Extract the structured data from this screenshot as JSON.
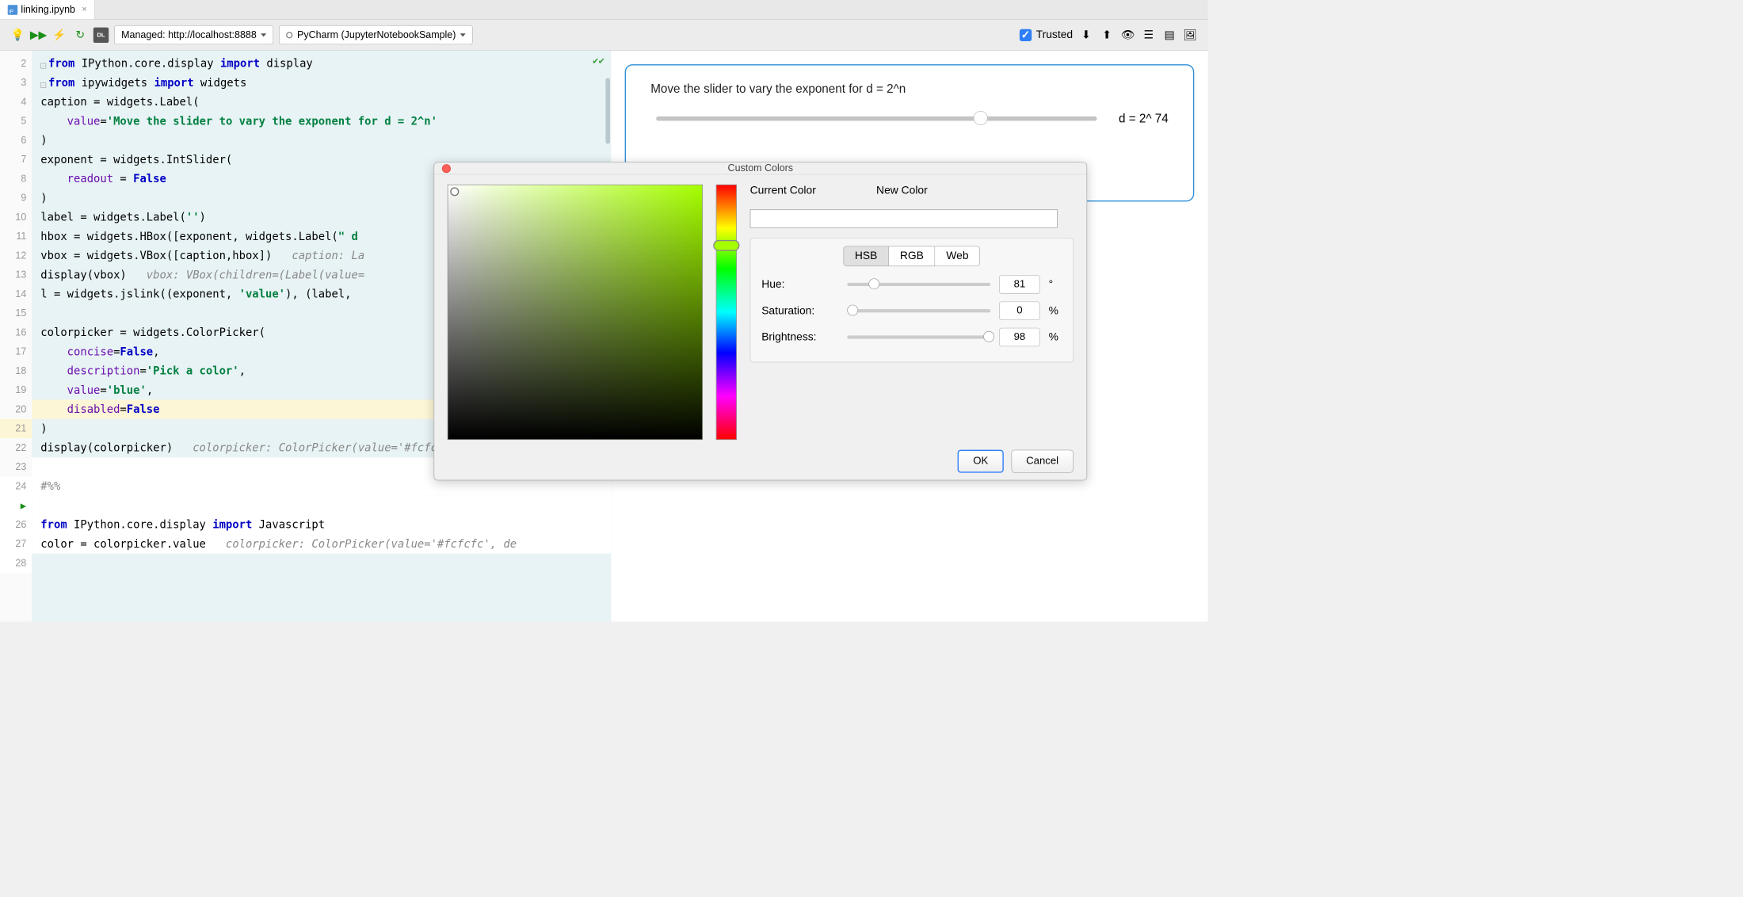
{
  "tab": {
    "filename": "linking.ipynb"
  },
  "toolbar": {
    "managed": "Managed: http://localhost:8888",
    "kernel": "PyCharm (JupyterNotebookSample)",
    "trusted": "Trusted"
  },
  "gutter": {
    "start": 2,
    "end": 28,
    "highlight": 21,
    "run_marker_at": 25
  },
  "code": [
    {
      "n": 2,
      "seg": [
        [
          "kw",
          "from"
        ],
        [
          "nm",
          " IPython.core.display "
        ],
        [
          "kw",
          "import"
        ],
        [
          "nm",
          " display"
        ]
      ]
    },
    {
      "n": 3,
      "seg": [
        [
          "kw",
          "from"
        ],
        [
          "nm",
          " ipywidgets "
        ],
        [
          "kw",
          "import"
        ],
        [
          "nm",
          " widgets"
        ]
      ]
    },
    {
      "n": 4,
      "seg": [
        [
          "nm",
          "caption = widgets.Label("
        ]
      ]
    },
    {
      "n": 5,
      "seg": [
        [
          "nm",
          "    "
        ],
        [
          "arg",
          "value"
        ],
        [
          "nm",
          "="
        ],
        [
          "str",
          "'Move the slider to vary the exponent for d = 2^n'"
        ]
      ]
    },
    {
      "n": 6,
      "seg": [
        [
          "nm",
          ")"
        ]
      ]
    },
    {
      "n": 7,
      "seg": [
        [
          "nm",
          "exponent = widgets.IntSlider("
        ]
      ]
    },
    {
      "n": 8,
      "seg": [
        [
          "nm",
          "    "
        ],
        [
          "arg",
          "readout"
        ],
        [
          "nm",
          " = "
        ],
        [
          "cst",
          "False"
        ]
      ]
    },
    {
      "n": 9,
      "seg": [
        [
          "nm",
          ")"
        ]
      ]
    },
    {
      "n": 10,
      "seg": [
        [
          "nm",
          "label = widgets.Label("
        ],
        [
          "str",
          "''"
        ],
        [
          "nm",
          ")"
        ]
      ]
    },
    {
      "n": 11,
      "seg": [
        [
          "nm",
          "hbox = widgets.HBox([exponent, widgets.Label("
        ],
        [
          "str",
          "\" d"
        ]
      ]
    },
    {
      "n": 12,
      "seg": [
        [
          "nm",
          "vbox = widgets.VBox([caption,hbox])   "
        ],
        [
          "cmt",
          "caption: La"
        ]
      ]
    },
    {
      "n": 13,
      "seg": [
        [
          "nm",
          "display(vbox)   "
        ],
        [
          "cmt",
          "vbox: VBox(children=(Label(value="
        ]
      ]
    },
    {
      "n": 14,
      "seg": [
        [
          "nm",
          "l = widgets.jslink((exponent, "
        ],
        [
          "str",
          "'value'"
        ],
        [
          "nm",
          "), (label,"
        ]
      ]
    },
    {
      "n": 15,
      "seg": [
        [
          "nm",
          ""
        ]
      ]
    },
    {
      "n": 16,
      "seg": [
        [
          "nm",
          "colorpicker = widgets.ColorPicker("
        ]
      ]
    },
    {
      "n": 17,
      "seg": [
        [
          "nm",
          "    "
        ],
        [
          "arg",
          "concise"
        ],
        [
          "nm",
          "="
        ],
        [
          "cst",
          "False"
        ],
        [
          "nm",
          ","
        ]
      ]
    },
    {
      "n": 18,
      "seg": [
        [
          "nm",
          "    "
        ],
        [
          "arg",
          "description"
        ],
        [
          "nm",
          "="
        ],
        [
          "str",
          "'Pick a color'"
        ],
        [
          "nm",
          ","
        ]
      ]
    },
    {
      "n": 19,
      "seg": [
        [
          "nm",
          "    "
        ],
        [
          "arg",
          "value"
        ],
        [
          "nm",
          "="
        ],
        [
          "str",
          "'blue'"
        ],
        [
          "nm",
          ","
        ]
      ]
    },
    {
      "n": 20,
      "seg": [
        [
          "nm",
          "    "
        ],
        [
          "arg",
          "disabled"
        ],
        [
          "nm",
          "="
        ],
        [
          "cst",
          "False"
        ]
      ],
      "hl": true
    },
    {
      "n": 21,
      "seg": [
        [
          "nm",
          ")"
        ]
      ]
    },
    {
      "n": 22,
      "seg": [
        [
          "nm",
          "display(colorpicker)   "
        ],
        [
          "cmt",
          "colorpicker: ColorPicker(value='#fcfcfc', descrip"
        ]
      ]
    },
    {
      "n": 23,
      "seg": [
        [
          "nm",
          ""
        ]
      ],
      "white": true
    },
    {
      "n": 24,
      "seg": [
        [
          "cmt",
          "#%%"
        ]
      ],
      "white": true
    },
    {
      "n": 25,
      "seg": [
        [
          "nm",
          ""
        ]
      ],
      "white": true
    },
    {
      "n": 26,
      "seg": [
        [
          "kw",
          "from"
        ],
        [
          "nm",
          " IPython.core.display "
        ],
        [
          "kw",
          "import"
        ],
        [
          "nm",
          " Javascript"
        ]
      ],
      "white": true
    },
    {
      "n": 27,
      "seg": [
        [
          "nm",
          "color = colorpicker.value   "
        ],
        [
          "cmt",
          "colorpicker: ColorPicker(value='#fcfcfc', de"
        ]
      ],
      "white": true
    }
  ],
  "output": {
    "caption": "Move the slider to vary the exponent for d = 2^n",
    "value_label": "d = 2^ 74",
    "slider_percent": 72
  },
  "colordlg": {
    "title": "Custom Colors",
    "current_label": "Current Color",
    "new_label": "New Color",
    "tabs": [
      "HSB",
      "RGB",
      "Web"
    ],
    "active_tab": 0,
    "rows": [
      {
        "label": "Hue:",
        "value": "81",
        "unit": "°",
        "thumb": 15
      },
      {
        "label": "Saturation:",
        "value": "0",
        "unit": "%",
        "thumb": 0
      },
      {
        "label": "Brightness:",
        "value": "98",
        "unit": "%",
        "thumb": 95
      }
    ],
    "ok": "OK",
    "cancel": "Cancel",
    "hue_deg": 81
  }
}
